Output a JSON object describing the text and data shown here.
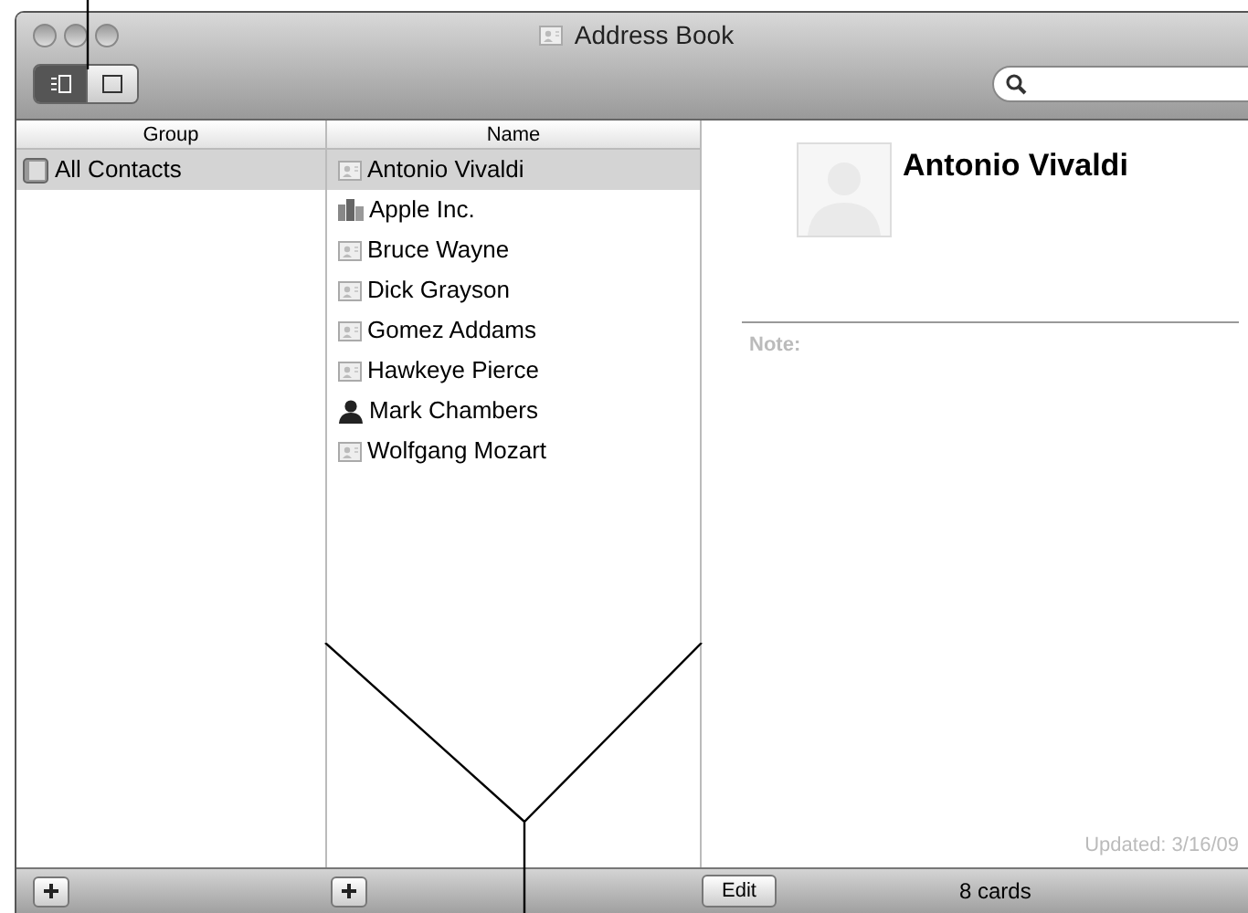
{
  "window": {
    "title": "Address Book"
  },
  "view_toggle": [
    {
      "kind": "columns",
      "selected": true
    },
    {
      "kind": "card",
      "selected": false
    }
  ],
  "search": {
    "kind": "rounded"
  },
  "groups": {
    "heading": "Group",
    "items": [
      {
        "label": "All Contacts",
        "selected": true
      }
    ]
  },
  "names": {
    "heading": "Name",
    "items": [
      {
        "label": "Antonio Vivaldi",
        "kind": "card",
        "selected": true
      },
      {
        "label": "Apple Inc.",
        "kind": "company",
        "selected": false
      },
      {
        "label": "Bruce Wayne",
        "kind": "card",
        "selected": false
      },
      {
        "label": "Dick Grayson",
        "kind": "card",
        "selected": false
      },
      {
        "label": "Gomez Addams",
        "kind": "card",
        "selected": false
      },
      {
        "label": "Hawkeye Pierce",
        "kind": "card",
        "selected": false
      },
      {
        "label": "Mark Chambers",
        "kind": "person",
        "selected": false
      },
      {
        "label": "Wolfgang Mozart",
        "kind": "card",
        "selected": false
      }
    ]
  },
  "detail": {
    "name": "Antonio Vivaldi",
    "note_label": "Note:",
    "updated": "Updated: 3/16/09"
  },
  "bottom_bar": {
    "edit_button": "Edit",
    "count": "8 cards"
  }
}
